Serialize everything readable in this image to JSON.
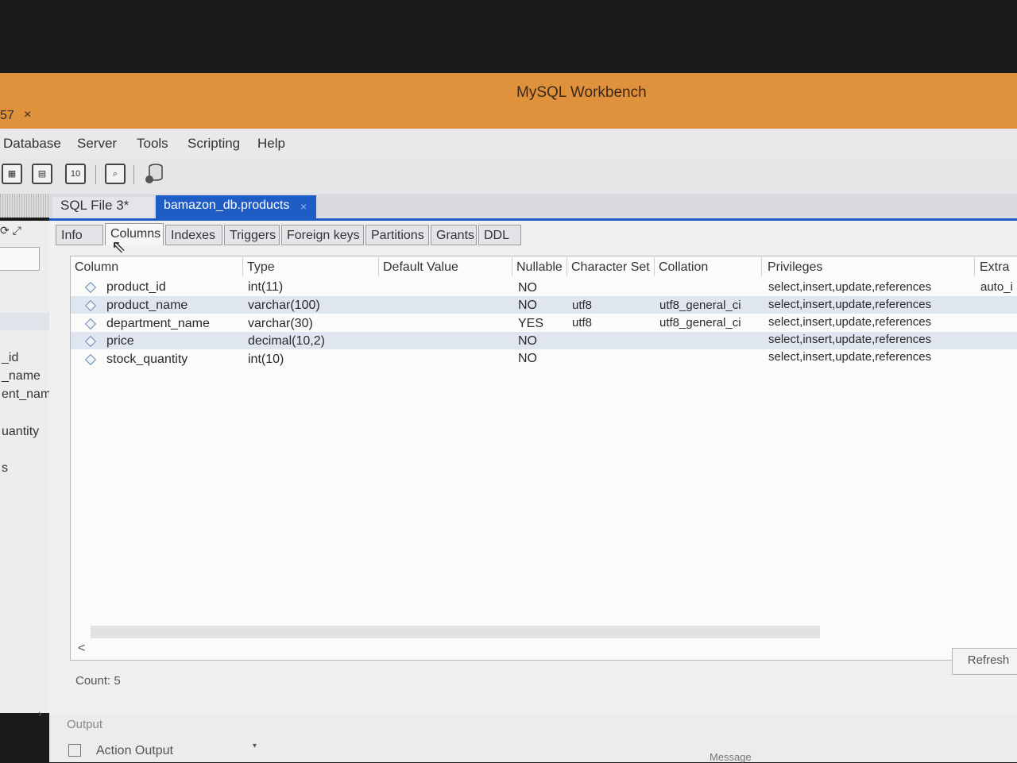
{
  "window": {
    "title": "MySQL Workbench"
  },
  "connection_tab": {
    "label": "57",
    "close": "×"
  },
  "menu": [
    "Database",
    "Server",
    "Tools",
    "Scripting",
    "Help"
  ],
  "toolbar": {
    "icons": [
      "new-sql-tab-icon",
      "open-sql-file-icon",
      "sql-options-icon",
      "inspector-icon",
      "database-config-icon"
    ],
    "badge_10": "10"
  },
  "doc_tabs": [
    {
      "label": "SQL File 3*"
    },
    {
      "label": "bamazon_db.products",
      "close": "×"
    }
  ],
  "sidebar": {
    "icons": "⟳ ⤢",
    "items": [
      "_id",
      "_name",
      "ent_nam",
      "uantity",
      "s"
    ]
  },
  "subtabs": [
    "Info",
    "Columns",
    "Indexes",
    "Triggers",
    "Foreign keys",
    "Partitions",
    "Grants",
    "DDL"
  ],
  "table": {
    "headers": [
      "Column",
      "Type",
      "Default Value",
      "Nullable",
      "Character Set",
      "Collation",
      "Privileges",
      "Extra"
    ],
    "rows": [
      [
        "product_id",
        "int(11)",
        "",
        "NO",
        "",
        "",
        "select,insert,update,references",
        "auto_i"
      ],
      [
        "product_name",
        "varchar(100)",
        "",
        "NO",
        "utf8",
        "utf8_general_ci",
        "select,insert,update,references",
        ""
      ],
      [
        "department_name",
        "varchar(30)",
        "",
        "YES",
        "utf8",
        "utf8_general_ci",
        "select,insert,update,references",
        ""
      ],
      [
        "price",
        "decimal(10,2)",
        "",
        "NO",
        "",
        "",
        "select,insert,update,references",
        ""
      ],
      [
        "stock_quantity",
        "int(10)",
        "",
        "NO",
        "",
        "",
        "select,insert,update,references",
        ""
      ]
    ]
  },
  "scroll_left": "<",
  "refresh_label": "Refresh",
  "count_label": "Count: 5",
  "output": {
    "label": "Output",
    "action_output": "Action Output",
    "dropdown": "▾",
    "message_header": "Message"
  },
  "colors": {
    "title_bar": "#e0913c",
    "active_tab": "#1f5dc4",
    "alt_row": "#dfe6f0"
  }
}
